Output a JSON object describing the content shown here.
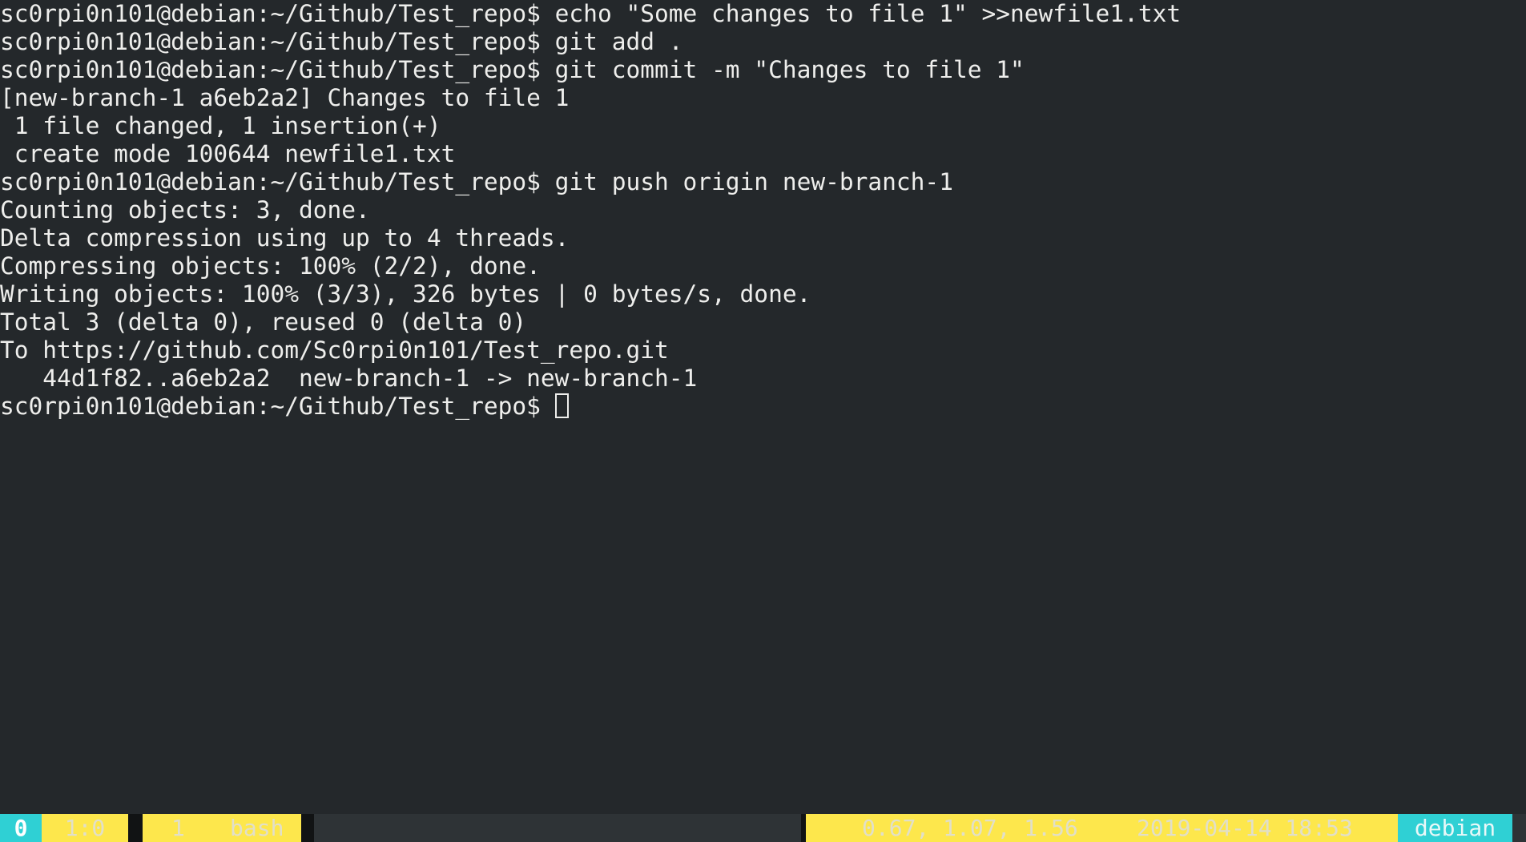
{
  "terminal": {
    "lines": [
      "sc0rpi0n101@debian:~/Github/Test_repo$ echo \"Some changes to file 1\" >>newfile1.txt",
      "sc0rpi0n101@debian:~/Github/Test_repo$ git add .",
      "sc0rpi0n101@debian:~/Github/Test_repo$ git commit -m \"Changes to file 1\"",
      "[new-branch-1 a6eb2a2] Changes to file 1",
      " 1 file changed, 1 insertion(+)",
      " create mode 100644 newfile1.txt",
      "sc0rpi0n101@debian:~/Github/Test_repo$ git push origin new-branch-1",
      "Counting objects: 3, done.",
      "Delta compression using up to 4 threads.",
      "Compressing objects: 100% (2/2), done.",
      "Writing objects: 100% (3/3), 326 bytes | 0 bytes/s, done.",
      "Total 3 (delta 0), reused 0 (delta 0)",
      "To https://github.com/Sc0rpi0n101/Test_repo.git",
      "   44d1f82..a6eb2a2  new-branch-1 -> new-branch-1"
    ],
    "prompt": "sc0rpi0n101@debian:~/Github/Test_repo$ "
  },
  "statusbar": {
    "session": "0",
    "pane": "1:0",
    "window_index": "1",
    "window_name": "bash",
    "load": "0.67, 1.07, 1.56",
    "datetime": "2019-04-14 18:53",
    "hostname": "debian"
  },
  "colors": {
    "background": "#24282b",
    "foreground": "#eeeeec",
    "status_yellow": "#fde74c",
    "status_cyan": "#2fd0d4",
    "status_bar": "#2e3336"
  }
}
